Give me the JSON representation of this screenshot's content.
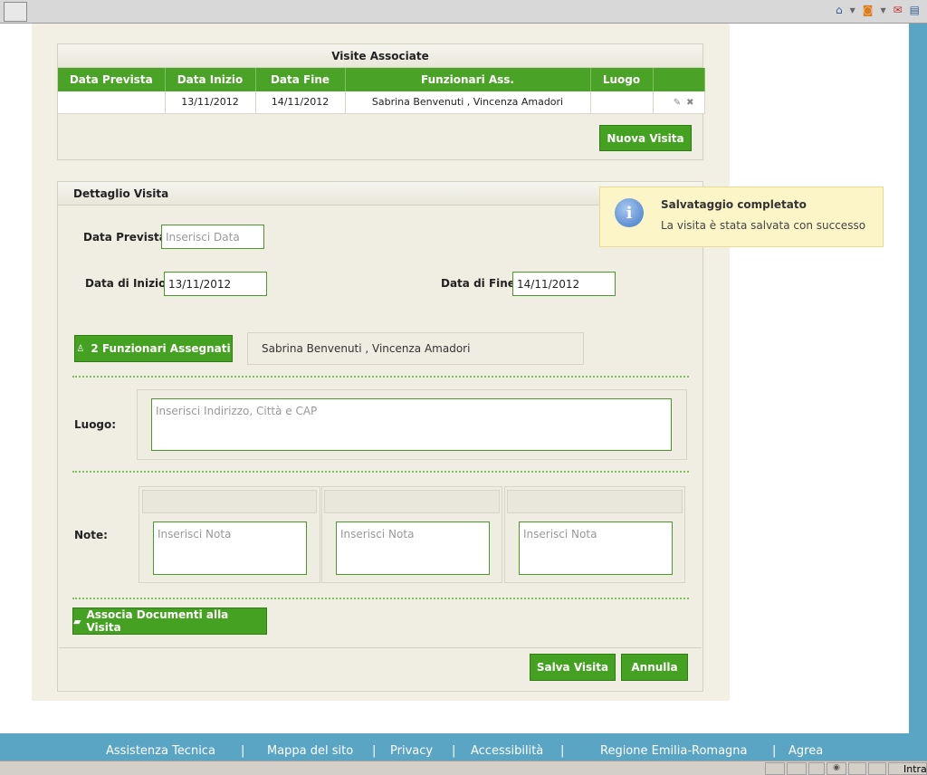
{
  "browser": {
    "icons": [
      "home-icon",
      "dropdown-arrow-icon",
      "rss-icon",
      "dropdown-arrow-icon",
      "mail-icon",
      "print-icon"
    ]
  },
  "visite": {
    "title": "Visite Associate",
    "columns": [
      "Data Prevista",
      "Data Inizio",
      "Data Fine",
      "Funzionari Ass.",
      "Luogo",
      ""
    ],
    "rows": [
      {
        "data_prevista": "",
        "data_inizio": "13/11/2012",
        "data_fine": "14/11/2012",
        "funzionari": "Sabrina Benvenuti , Vincenza Amadori",
        "luogo": ""
      }
    ],
    "nuova_button": "Nuova Visita"
  },
  "dettaglio": {
    "title": "Dettaglio Visita",
    "data_prevista_label": "Data Prevista:",
    "data_prevista_placeholder": "Inserisci Data",
    "data_inizio_label": "Data di Inizio:",
    "data_inizio_value": "13/11/2012",
    "data_fine_label": "Data di Fine:",
    "data_fine_value": "14/11/2012",
    "funzionari_button": "2 Funzionari Assegnati",
    "funzionari_value": "Sabrina Benvenuti , Vincenza Amadori",
    "luogo_label": "Luogo:",
    "luogo_placeholder": "Inserisci Indirizzo, Città e CAP",
    "note_label": "Note:",
    "note_placeholder": "Inserisci Nota",
    "documenti_button": "Associa Documenti alla Visita",
    "salva_button": "Salva Visita",
    "annulla_button": "Annulla"
  },
  "toast": {
    "title": "Salvataggio completato",
    "message": "La visita è stata salvata con successo"
  },
  "footer": {
    "links": [
      "Assistenza Tecnica",
      "Mappa del sito",
      "Privacy",
      "Accessibilità",
      "Regione Emilia-Romagna",
      "Agrea"
    ]
  },
  "statusbar": {
    "zone": "Intra"
  },
  "colors": {
    "accent_green": "#45a121",
    "toast_bg": "#fcf5c8",
    "footer_blue": "#5ba5c4"
  }
}
